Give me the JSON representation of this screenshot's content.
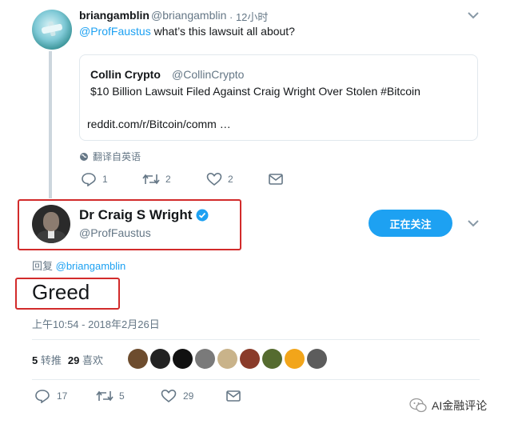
{
  "tweet1": {
    "name": "briangamblin",
    "handle": "@briangamblin",
    "time": "· 12小时",
    "mention": "@ProfFaustus",
    "text": " what’s this lawsuit all about?",
    "quote": {
      "name": "Collin Crypto",
      "handle": "@CollinCrypto",
      "text": "$10 Billion Lawsuit Filed Against Craig Wright Over Stolen #Bitcoin",
      "link": "reddit.com/r/Bitcoin/comm …"
    },
    "translate_label": "翻译自英语",
    "actions": {
      "replies": "1",
      "retweets": "2",
      "likes": "2"
    }
  },
  "tweet2": {
    "name": "Dr Craig S Wright",
    "handle": "@ProfFaustus",
    "follow_label": "正在关注",
    "reply_prefix": "回复 ",
    "reply_mention": "@briangamblin",
    "text": "Greed",
    "timestamp": "上午10:54 - 2018年2月26日",
    "stats": {
      "retweets_count": "5",
      "retweets_label": "转推",
      "likes_count": "29",
      "likes_label": "喜欢"
    },
    "actions": {
      "replies": "17",
      "retweets": "5",
      "likes": "29"
    }
  },
  "likers": [
    {
      "icon": "liker-avatar",
      "color": "#6d4c2e"
    },
    {
      "icon": "liker-avatar",
      "color": "#222222"
    },
    {
      "icon": "liker-avatar",
      "color": "#111111"
    },
    {
      "icon": "liker-avatar",
      "color": "#7a7a7a"
    },
    {
      "icon": "liker-avatar",
      "color": "#c9b38a"
    },
    {
      "icon": "liker-avatar",
      "color": "#8a3b2a"
    },
    {
      "icon": "liker-avatar",
      "color": "#556b2f"
    },
    {
      "icon": "liker-avatar",
      "color": "#f2a51a"
    },
    {
      "icon": "liker-avatar",
      "color": "#5c5c5c"
    }
  ],
  "watermark": "AI金融评论",
  "colors": {
    "accent": "#1da1f2",
    "highlight_box": "#d22b2b",
    "muted": "#657786"
  }
}
